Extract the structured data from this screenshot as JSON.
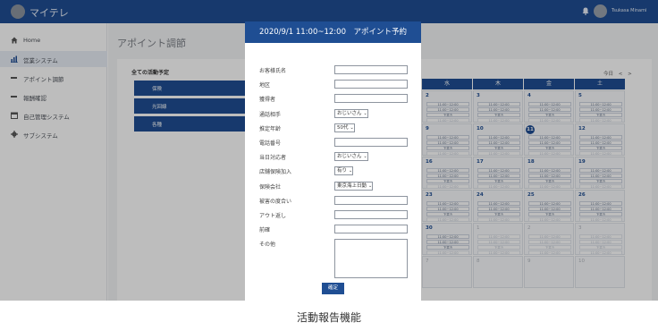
{
  "app": {
    "title": "マイテレ",
    "user_name": "Tsukasa Minami"
  },
  "sidebar": {
    "items": [
      {
        "label": "Home",
        "icon": "home-icon"
      },
      {
        "label": "営業システム",
        "icon": "bar-chart-icon"
      },
      {
        "label": "アポイント調節",
        "icon": "dash-icon"
      },
      {
        "label": "報酬確認",
        "icon": "dash-icon"
      },
      {
        "label": "自己管理システム",
        "icon": "calendar-icon"
      },
      {
        "label": "サブシステム",
        "icon": "gear-icon"
      }
    ]
  },
  "main": {
    "heading": "アポイント調節",
    "card_title": "全ての活動予定",
    "filters": [
      "保険",
      "光回線",
      "各種"
    ],
    "calendar": {
      "nav": {
        "label": "今日",
        "prev": "<",
        "next": ">"
      },
      "weekdays": [
        "水",
        "木",
        "金",
        "土"
      ],
      "rows": [
        [
          "2",
          "3",
          "4",
          "5"
        ],
        [
          "9",
          "10",
          "11",
          "12"
        ],
        [
          "16",
          "17",
          "18",
          "19"
        ],
        [
          "23",
          "24",
          "25",
          "26"
        ],
        [
          "30",
          "1",
          "2",
          "3"
        ],
        [
          "7",
          "8",
          "9",
          "10"
        ]
      ],
      "slot_text": "11:00~12:00",
      "slot_status": "下書き"
    }
  },
  "modal": {
    "title": "2020/9/1 11:00~12:00　アポイント予約",
    "fields": [
      {
        "label": "お客様氏名",
        "type": "input",
        "value": ""
      },
      {
        "label": "地区",
        "type": "input",
        "value": ""
      },
      {
        "label": "獲得者",
        "type": "input",
        "value": ""
      },
      {
        "label": "通話相手",
        "type": "select",
        "value": "おじいさん"
      },
      {
        "label": "推定年齢",
        "type": "select",
        "value": "50代"
      },
      {
        "label": "電話番号",
        "type": "input",
        "value": ""
      },
      {
        "label": "当日対応者",
        "type": "select",
        "value": "おじいさん"
      },
      {
        "label": "店舗保険加入",
        "type": "select",
        "value": "有り"
      },
      {
        "label": "保険会社",
        "type": "select",
        "value": "東京海上日動"
      },
      {
        "label": "被害の度合い",
        "type": "input",
        "value": ""
      },
      {
        "label": "アウト返し",
        "type": "input",
        "value": ""
      },
      {
        "label": "前確",
        "type": "input",
        "value": ""
      },
      {
        "label": "その他",
        "type": "textarea",
        "value": ""
      }
    ],
    "confirm_label": "確定"
  },
  "caption": "活動報告機能",
  "colors": {
    "primary": "#1f4e93",
    "overlay": "rgba(0,0,0,0.26)",
    "background": "#f3f4f6"
  }
}
